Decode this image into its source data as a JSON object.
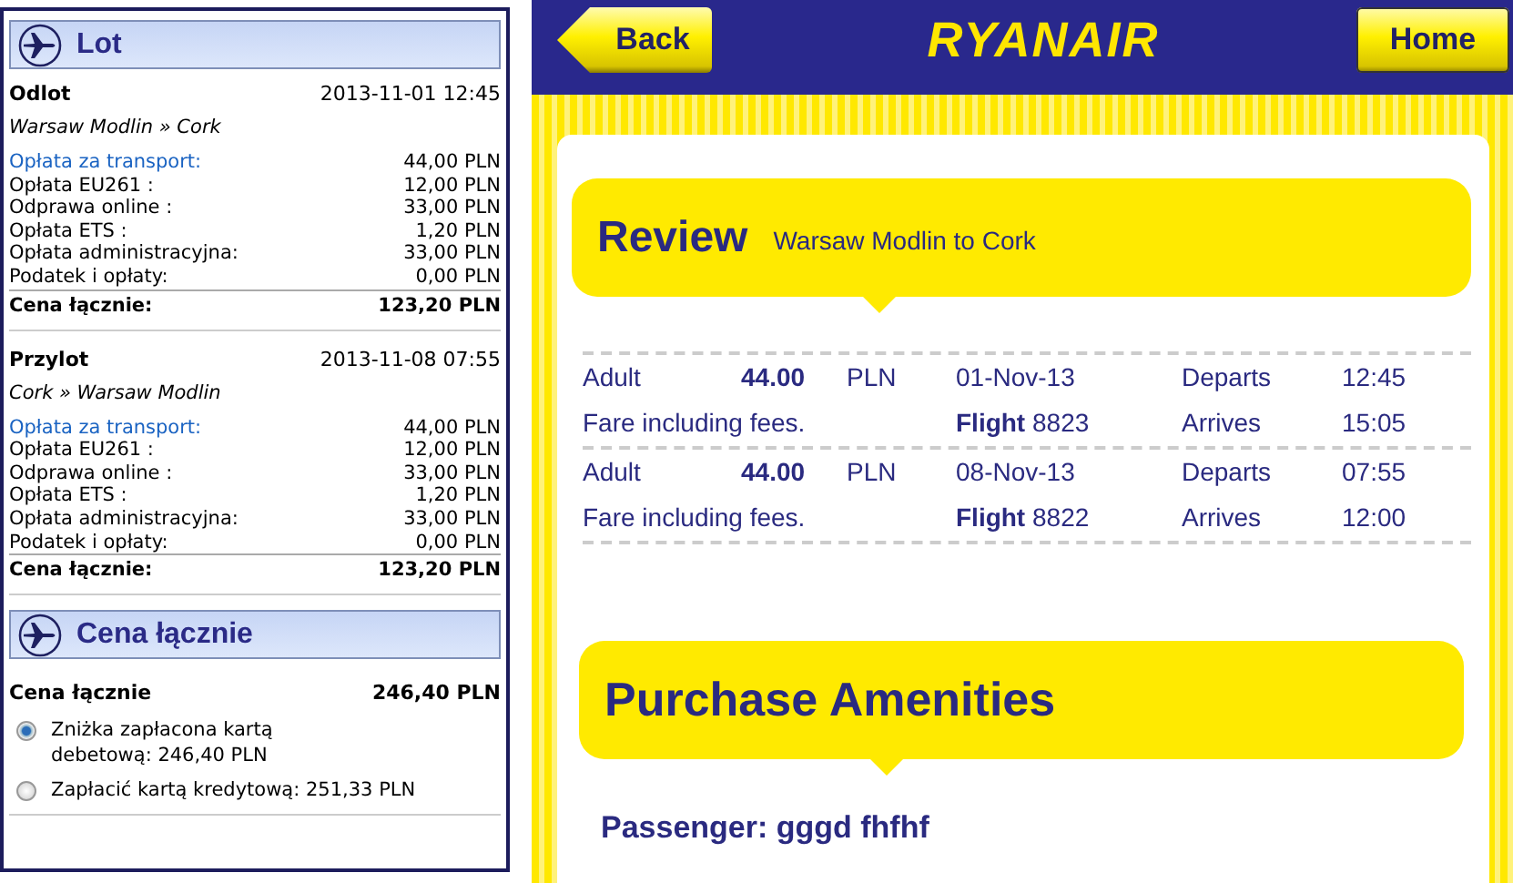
{
  "summary": {
    "sections": [
      {
        "kind": "legs",
        "title": "Lot",
        "legs": [
          {
            "label": "Odlot",
            "datetime": "2013-11-01 12:45",
            "route": "Warsaw Modlin » Cork",
            "fees": [
              {
                "kind": "link",
                "label": "Opłata za transport:",
                "amount": "44,00 PLN"
              },
              {
                "kind": "text",
                "label": "Opłata EU261 :",
                "amount": "12,00 PLN"
              },
              {
                "kind": "text",
                "label": "Odprawa online :",
                "amount": "33,00 PLN"
              },
              {
                "kind": "text",
                "label": "Opłata ETS :",
                "amount": "1,20 PLN"
              },
              {
                "kind": "text",
                "label": "Opłata administracyjna:",
                "amount": "33,00 PLN"
              },
              {
                "kind": "text",
                "label": "Podatek i opłaty:",
                "amount": "0,00 PLN"
              }
            ],
            "total_label": "Cena łącznie:",
            "total": "123,20 PLN"
          },
          {
            "label": "Przylot",
            "datetime": "2013-11-08 07:55",
            "route": "Cork » Warsaw Modlin",
            "fees": [
              {
                "kind": "link",
                "label": "Opłata za transport:",
                "amount": "44,00 PLN"
              },
              {
                "kind": "text",
                "label": "Opłata EU261 :",
                "amount": "12,00 PLN"
              },
              {
                "kind": "text",
                "label": "Odprawa online :",
                "amount": "33,00 PLN"
              },
              {
                "kind": "text",
                "label": "Opłata ETS :",
                "amount": "1,20 PLN"
              },
              {
                "kind": "text",
                "label": "Opłata administracyjna:",
                "amount": "33,00 PLN"
              },
              {
                "kind": "text",
                "label": "Podatek i opłaty:",
                "amount": "0,00 PLN"
              }
            ],
            "total_label": "Cena łącznie:",
            "total": "123,20 PLN"
          }
        ]
      },
      {
        "kind": "total",
        "title": "Cena łącznie",
        "total_label": "Cena łącznie",
        "total": "246,40 PLN",
        "options": [
          {
            "text": "Zniżka zapłacona kartą debetową: 246,40 PLN",
            "selected": true
          },
          {
            "text": "Zapłacić kartą kredytową: 251,33 PLN",
            "selected": false
          }
        ]
      }
    ]
  },
  "app": {
    "back": "Back",
    "brand": "RYANAIR",
    "home": "Home"
  },
  "review": {
    "title": "Review",
    "subtitle": "Warsaw Modlin to Cork",
    "fares": [
      {
        "passenger": "Adult",
        "price": "44.00",
        "currency": "PLN",
        "date": "01-Nov-13",
        "departs_label": "Departs",
        "departs": "12:45",
        "note": "Fare including fees.",
        "flight": "**Flight** 8823",
        "arrives_label": "Arrives",
        "arrives": "15:05"
      },
      {
        "passenger": "Adult",
        "price": "44.00",
        "currency": "PLN",
        "date": "08-Nov-13",
        "departs_label": "Departs",
        "departs": "07:55",
        "note": "Fare including fees.",
        "flight": "**Flight** 8822",
        "arrives_label": "Arrives",
        "arrives": "12:00"
      }
    ]
  },
  "amenities": {
    "title": "Purchase Amenities",
    "passenger": "Passenger: gggd fhfhf"
  }
}
